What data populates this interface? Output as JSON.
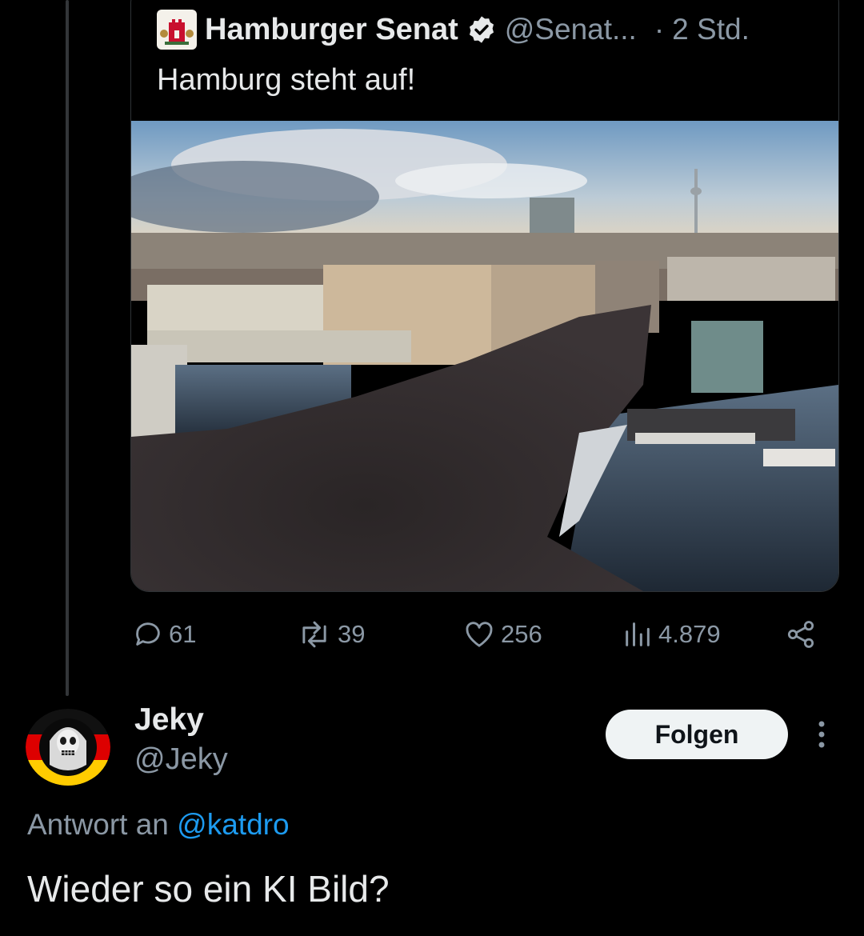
{
  "quoted_tweet": {
    "author_name": "Hamburger Senat",
    "handle": "@Senat...",
    "separator": "·",
    "time": "2 Std.",
    "text": "Hamburg steht auf!",
    "image_icon": "aerial-photo-demonstration-crowd-hamburg",
    "avatar_icon": "hamburg-coat-of-arms-icon",
    "verified_icon": "verified-badge-icon"
  },
  "actions": {
    "replies": "61",
    "reposts": "39",
    "likes": "256",
    "views": "4.879",
    "share_icon": "share-icon"
  },
  "reply": {
    "author_name": "Jeky",
    "handle": "@Jeky",
    "follow_label": "Folgen",
    "reply_to_prefix": "Antwort an",
    "reply_to_mention": "@katdro",
    "text": "Wieder so ein KI Bild?",
    "avatar_icon": "skull-avatar-german-flag-ring"
  },
  "colors": {
    "background": "#000000",
    "primary_text": "#e7e9ea",
    "secondary_text": "#8b98a5",
    "link": "#1d9bf0",
    "follow_button_bg": "#eff3f4"
  }
}
